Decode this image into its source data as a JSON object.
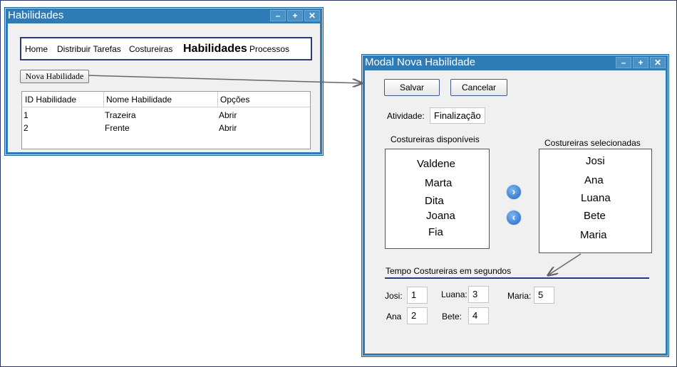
{
  "win1": {
    "title": "Habilidades",
    "nav": [
      {
        "label": "Home"
      },
      {
        "label": "Distribuir Tarefas"
      },
      {
        "label": "Costureiras"
      },
      {
        "label": "Habilidades"
      },
      {
        "label": "Processos"
      }
    ],
    "nova_button": "Nova Habilidade",
    "table": {
      "headers": [
        "ID Habilidade",
        "Nome Habilidade",
        "Opções"
      ],
      "rows": [
        [
          "1",
          "Trazeira",
          "Abrir"
        ],
        [
          "2",
          "Frente",
          "Abrir"
        ]
      ]
    }
  },
  "win2": {
    "title": "Modal Nova Habilidade",
    "save_label": "Salvar",
    "cancel_label": "Cancelar",
    "atividade_label": "Atividade:",
    "atividade_value": "Finalização",
    "disponiveis_title": "Costureiras disponíveis",
    "disponiveis": [
      "Valdene",
      "Marta",
      "Dita",
      "Joana",
      "Fia"
    ],
    "selecionadas_title": "Costureiras selecionadas",
    "selecionadas": [
      "Josi",
      "Ana",
      "Luana",
      "Bete",
      "Maria"
    ],
    "tempo_title": "Tempo Costureiras em segundos",
    "tempos": [
      {
        "label": "Josi:",
        "value": "1"
      },
      {
        "label": "Luana:",
        "value": "3"
      },
      {
        "label": "Maria:",
        "value": "5"
      },
      {
        "label": "Ana",
        "value": "2"
      },
      {
        "label": "Bete:",
        "value": "4"
      }
    ]
  },
  "window_controls": {
    "minimize": "–",
    "maximize": "+",
    "close": "✕"
  },
  "colors": {
    "titlebar": "#2e7bb5",
    "nav_border": "#2b3a7a",
    "divider": "#1c3a86"
  }
}
